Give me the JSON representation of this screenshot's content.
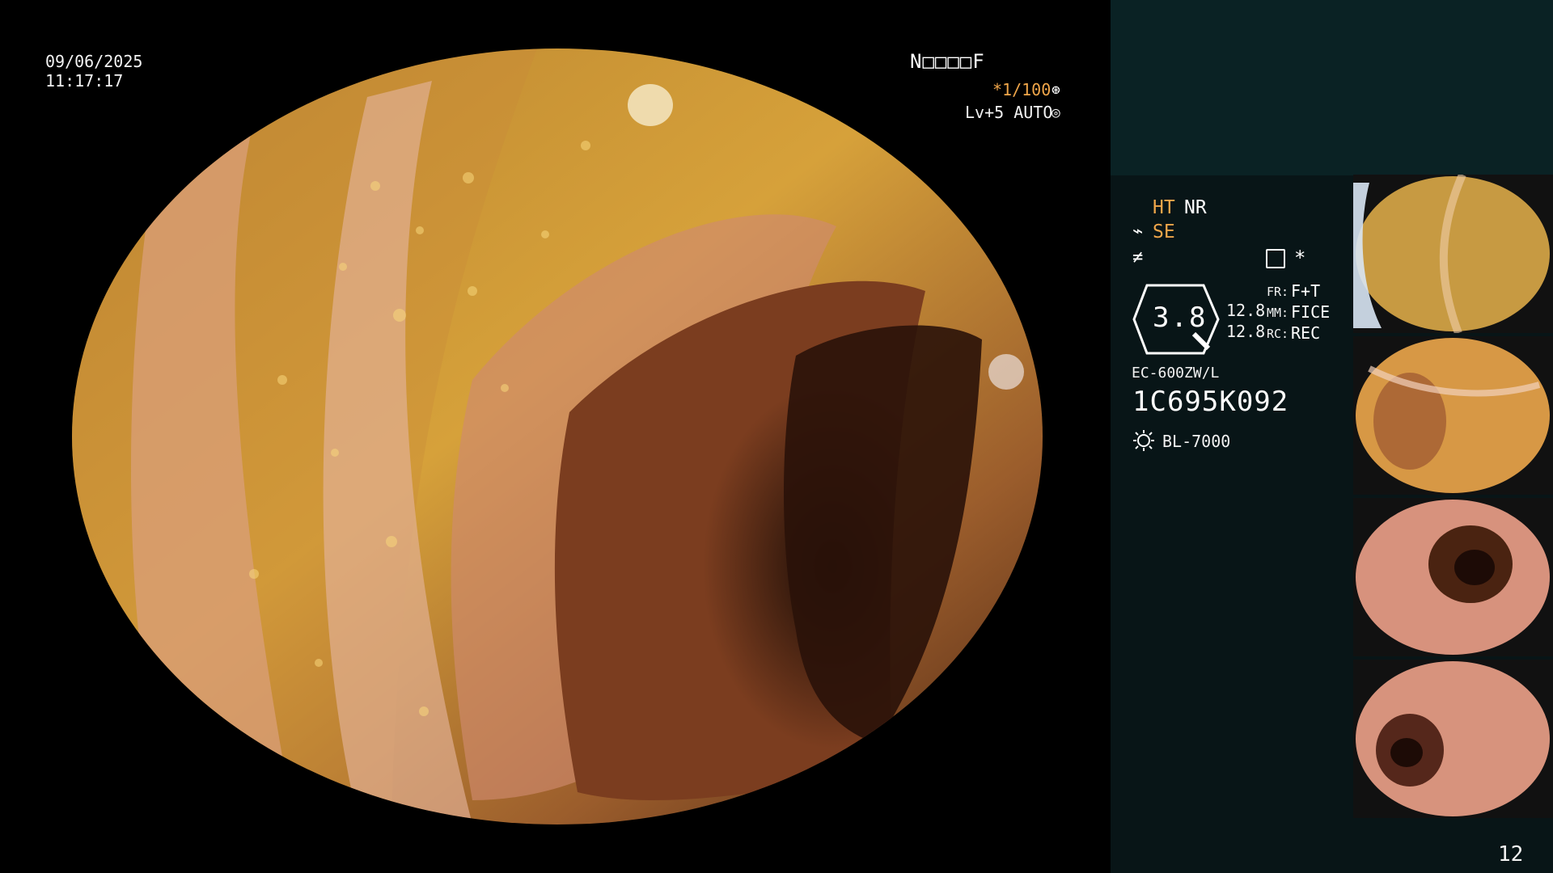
{
  "monitor": {
    "date": "09/06/2025",
    "time": "11:17:17",
    "mode_code": "N□□□□F",
    "shutter": "*1/100",
    "shutter_icon": "aperture-icon",
    "level": "Lv+5 AUTO",
    "level_icon": "auto-iris-icon"
  },
  "panel": {
    "ht": "HT",
    "nr": "NR",
    "se": "SE",
    "se_icon": "signal-icon",
    "f_icon": "flat-icon",
    "menu_icon": "menu-icon",
    "star": "*",
    "zoom": "3.8",
    "value_1": "12.8",
    "value_2": "12.8",
    "fr_label": "FR:",
    "fr_value": "F+T",
    "mm_label": "MM:",
    "mm_value": "FICE",
    "rc_label": "RC:",
    "rc_value": "REC",
    "model": "EC-600ZW/L",
    "serial": "1C695K092",
    "light_source_icon": "light-icon",
    "light_source": "BL-7000",
    "page_number": "12"
  },
  "colors": {
    "orange": "#f0a64a",
    "panel_dark": "#081517",
    "panel_top": "#0a2224"
  }
}
